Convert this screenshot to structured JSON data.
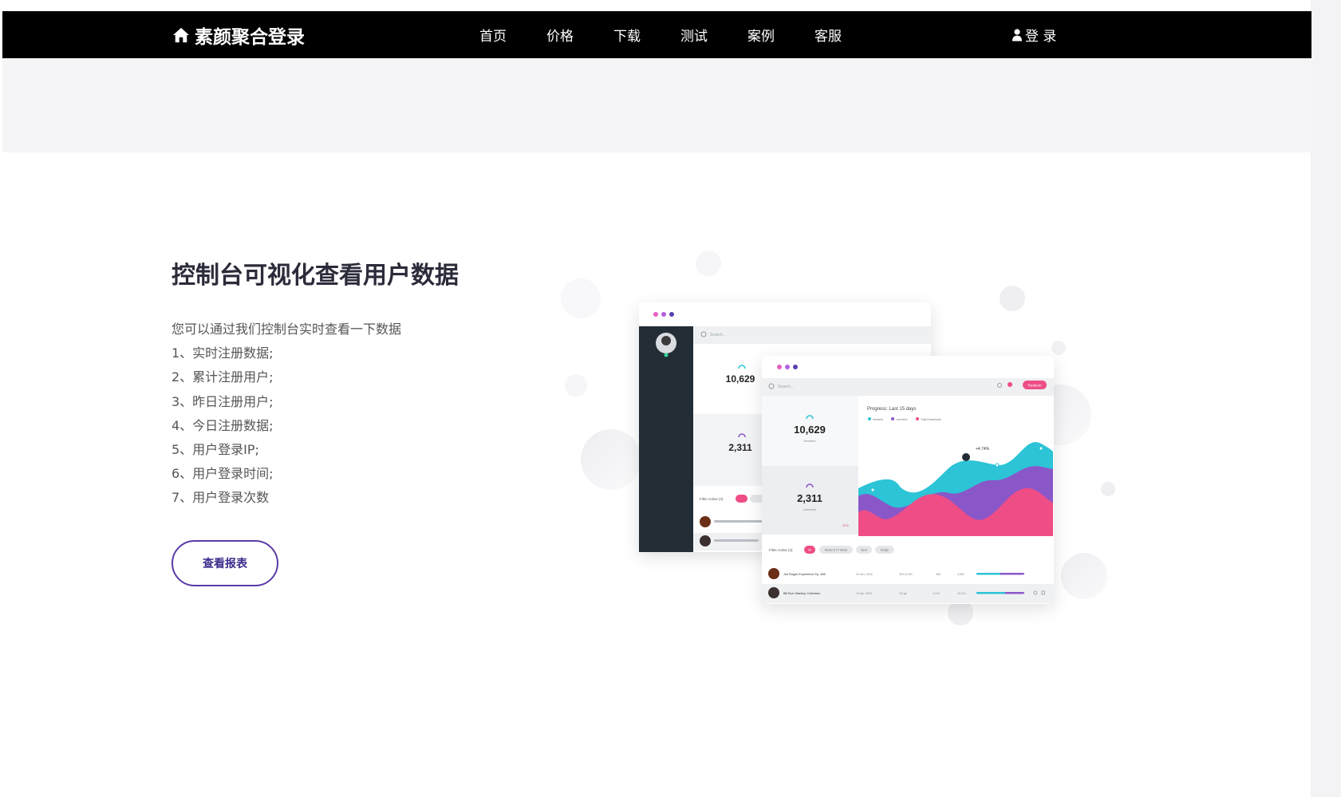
{
  "header": {
    "brand": "素颜聚合登录",
    "nav": [
      "首页",
      "价格",
      "下载",
      "测试",
      "案例",
      "客服"
    ],
    "login": "登 录"
  },
  "section": {
    "title": "控制台可视化查看用户数据",
    "lines": [
      "您可以通过我们控制台实时查看一下数据",
      "1、实时注册数据;",
      "2、累计注册用户;",
      "3、昨日注册用户;",
      "4、今日注册数据;",
      "5、用户登录IP;",
      "6、用户登录时间;",
      "7、用户登录次数"
    ],
    "button": "查看报表"
  },
  "mockup": {
    "back_window": {
      "search": "Search...",
      "stat1": "10,629",
      "stat2": "2,311",
      "files_label": "Files Active (4)"
    },
    "front_window": {
      "search": "Search...",
      "stat1_value": "10,629",
      "stat1_label": "Seeders",
      "stat2_value": "2,311",
      "stat2_label": "Leechers",
      "stat2_delta": "32%",
      "chart_title": "Progress: Last 15 days",
      "legend": [
        "Seeders",
        "Leechers",
        "Total Downloads"
      ],
      "callout": "+4.74%",
      "files_label": "Files Active (4)",
      "filters": [
        "All",
        "Movies & TV Shows",
        "Sport",
        "Design"
      ],
      "rows": [
        {
          "name": "Joe Rogan Experience Ep. 468",
          "date": "20 Nov, 2016",
          "size": "303.23 Mb",
          "s1": "468",
          "s2": "3,532"
        },
        {
          "name": "Bill Burr Standup Collection",
          "date": "10 Apr, 2016",
          "size": "9.6 gb",
          "s1": "4,214",
          "s2": "10,214"
        }
      ],
      "button": "Redeem"
    },
    "colors": {
      "pink": "#ee4d86",
      "purple": "#8a57c9",
      "cyan": "#2cc4d6",
      "dark": "#232d36"
    }
  }
}
